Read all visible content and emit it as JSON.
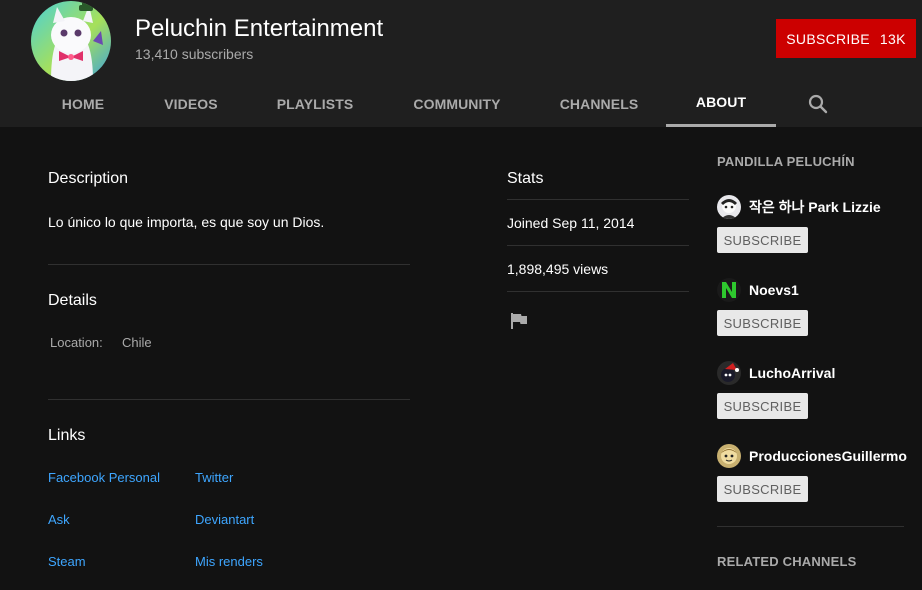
{
  "channel": {
    "name": "Peluchin Entertainment",
    "subscribers": "13,410 subscribers",
    "subscribe_label": "SUBSCRIBE",
    "subscribe_count": "13K"
  },
  "tabs": [
    {
      "label": "HOME"
    },
    {
      "label": "VIDEOS"
    },
    {
      "label": "PLAYLISTS"
    },
    {
      "label": "COMMUNITY"
    },
    {
      "label": "CHANNELS"
    },
    {
      "label": "ABOUT",
      "active": true
    }
  ],
  "about": {
    "description_title": "Description",
    "description_text": "Lo único lo que importa, es que soy un Dios.",
    "details_title": "Details",
    "location_label": "Location:",
    "location_value": "Chile",
    "links_title": "Links",
    "links": [
      "Facebook Personal",
      "Twitter",
      "Ask",
      "Deviantart",
      "Steam",
      "Mis renders"
    ]
  },
  "stats": {
    "title": "Stats",
    "joined": "Joined Sep 11, 2014",
    "views": "1,898,495 views"
  },
  "sidebar": {
    "featured_heading": "PANDILLA PELUCHÍN",
    "channels": [
      {
        "name": "작은 하나 Park Lizzie",
        "subscribe_label": "SUBSCRIBE"
      },
      {
        "name": "Noevs1",
        "subscribe_label": "SUBSCRIBE"
      },
      {
        "name": "LuchoArrival",
        "subscribe_label": "SUBSCRIBE"
      },
      {
        "name": "ProduccionesGuillermo",
        "subscribe_label": "SUBSCRIBE"
      }
    ],
    "related_heading": "RELATED CHANNELS"
  },
  "colors": {
    "background": "#121212",
    "header": "#1f1f1f",
    "subscribe_red": "#cc0000",
    "link_blue": "#3ea6ff"
  }
}
